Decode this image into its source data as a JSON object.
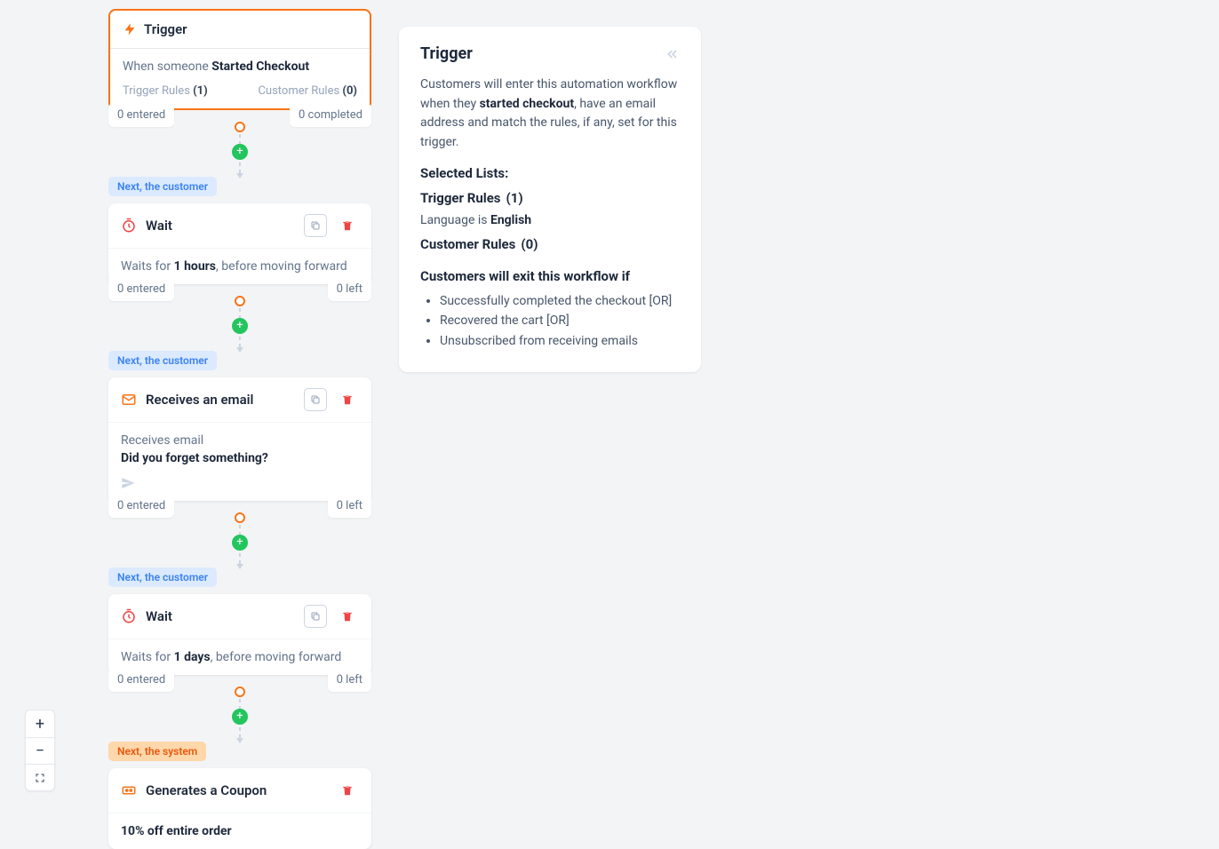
{
  "trigger": {
    "title": "Trigger",
    "prefix": "When someone ",
    "action": "Started Checkout",
    "triggerRulesLabel": "Trigger Rules ",
    "triggerRulesCount": "(1)",
    "customerRulesLabel": "Customer Rules ",
    "customerRulesCount": "(0)",
    "entered": "0 entered",
    "completed": "0 completed"
  },
  "labels": {
    "nextCustomer": "Next, the customer",
    "nextSystem": "Next, the system"
  },
  "steps": [
    {
      "title": "Wait",
      "descPrefix": "Waits for ",
      "descBold": "1 hours",
      "descSuffix": ", before moving forward",
      "left": "0 entered",
      "right": "0 left"
    },
    {
      "title": "Receives an email",
      "bodyLabel": "Receives email",
      "subject": "Did you forget something?",
      "left": "0 entered",
      "right": "0 left"
    },
    {
      "title": "Wait",
      "descPrefix": "Waits for ",
      "descBold": "1 days",
      "descSuffix": ", before moving forward",
      "left": "0 entered",
      "right": "0 left"
    },
    {
      "title": "Generates a Coupon",
      "coupon": "10% off entire order"
    }
  ],
  "panel": {
    "title": "Trigger",
    "introA": "Customers will enter this automation workflow when they ",
    "introBold": "started checkout",
    "introB": ", have an email address and match the rules, if any, set for this trigger.",
    "selectedLists": "Selected Lists:",
    "triggerRulesHeading": "Trigger Rules",
    "triggerRulesCount": "(1)",
    "ruleLinePrefix": "Language is ",
    "ruleLineBold": "English",
    "customerRulesHeading": "Customer Rules",
    "customerRulesCount": "(0)",
    "exitHeading": "Customers will exit this workflow if",
    "exit1": "Successfully completed the checkout [OR]",
    "exit2": "Recovered the cart [OR]",
    "exit3": "Unsubscribed from receiving emails"
  },
  "zoom": {
    "in": "+",
    "out": "−"
  }
}
